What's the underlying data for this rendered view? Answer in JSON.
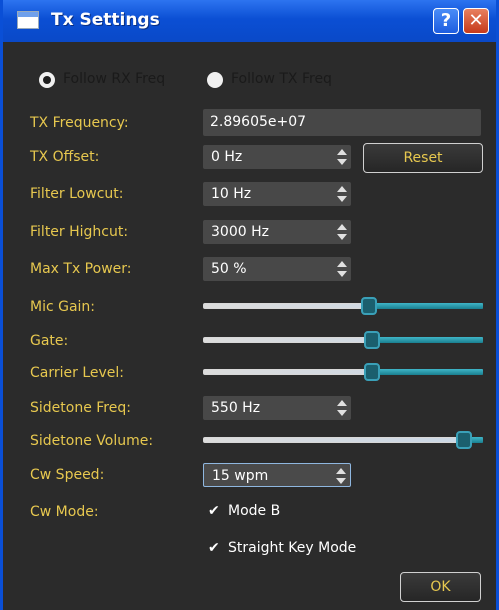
{
  "window": {
    "title": "Tx Settings",
    "help_glyph": "?",
    "close_glyph": "✕"
  },
  "freq_mode": [
    {
      "label": "Follow RX Freq",
      "selected": true
    },
    {
      "label": "Follow TX Freq",
      "selected": false
    }
  ],
  "labels": {
    "tx_frequency": "TX Frequency:",
    "tx_offset": "TX Offset:",
    "filter_lowcut": "Filter Lowcut:",
    "filter_highcut": "Filter Highcut:",
    "max_tx_power": "Max Tx Power:",
    "mic_gain": "Mic Gain:",
    "gate": "Gate:",
    "carrier_level": "Carrier Level:",
    "sidetone_freq": "Sidetone Freq:",
    "sidetone_volume": "Sidetone Volume:",
    "cw_speed": "Cw Speed:",
    "cw_mode": "Cw Mode:"
  },
  "values": {
    "tx_frequency": "2.89605e+07",
    "tx_offset": "0 Hz",
    "filter_lowcut": "10 Hz",
    "filter_highcut": "3000 Hz",
    "max_tx_power": "50 %",
    "sidetone_freq": "550 Hz",
    "cw_speed": "15 wpm"
  },
  "sliders": {
    "mic_gain": 0.6,
    "gate": 0.61,
    "carrier_level": 0.61,
    "sidetone_volume": 0.96
  },
  "buttons": {
    "reset": "Reset",
    "ok": "OK"
  },
  "cw_options": [
    {
      "label": "Mode B",
      "checked": true,
      "check_glyph": "✔"
    },
    {
      "label": "Straight Key Mode",
      "checked": true,
      "check_glyph": "✔"
    }
  ],
  "colors": {
    "label": "#e7c84f",
    "background": "#2b2b2b",
    "titlebar": "#0b4fd4",
    "slider_accent": "#1a7f90"
  }
}
